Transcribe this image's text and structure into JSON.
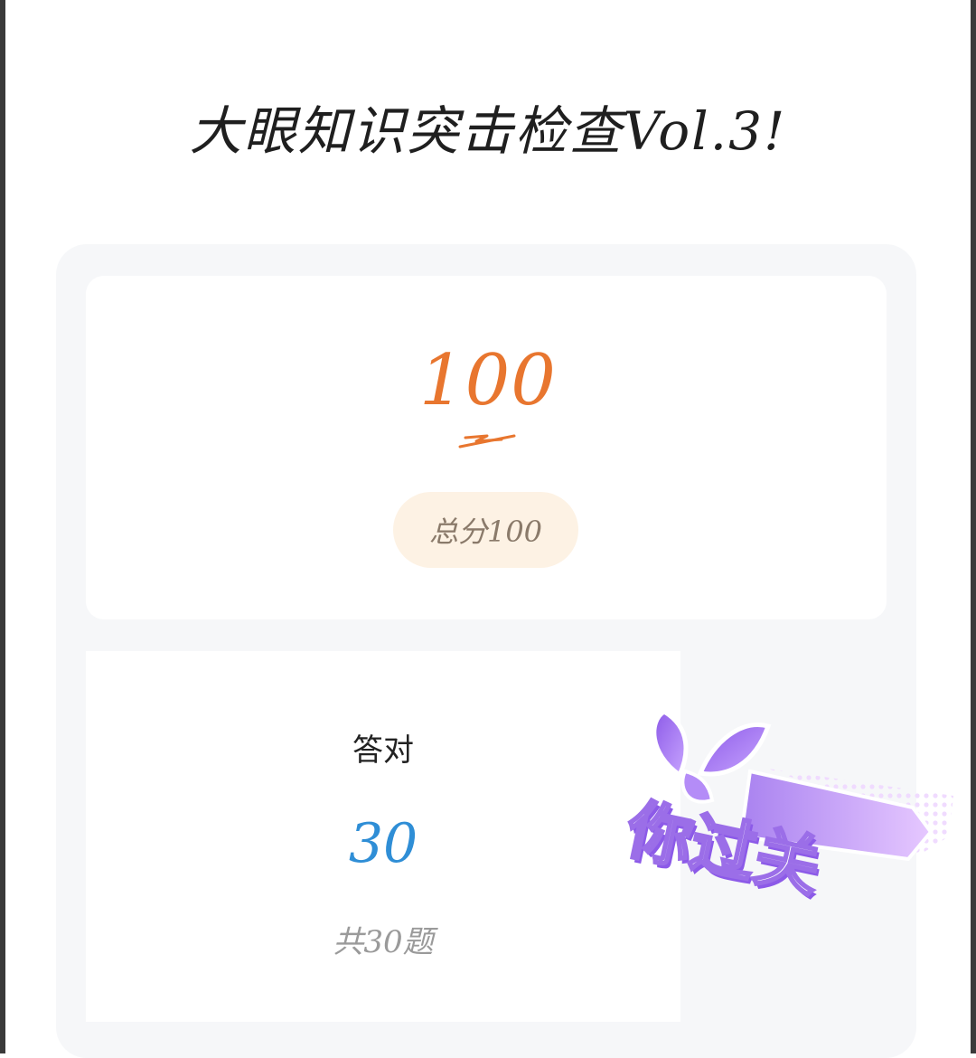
{
  "page": {
    "title": "大眼知识突击检查Vol.3!"
  },
  "score": {
    "value": "100",
    "total_label": "总分100"
  },
  "correct": {
    "label": "答对",
    "value": "30",
    "total_label": "共30题"
  },
  "sticker": {
    "text": "你过关"
  },
  "colors": {
    "accent_orange": "#e8762f",
    "accent_blue": "#2f8ed6",
    "sticker_purple": "#9b6ee8",
    "card_background": "#f6f7f9"
  }
}
